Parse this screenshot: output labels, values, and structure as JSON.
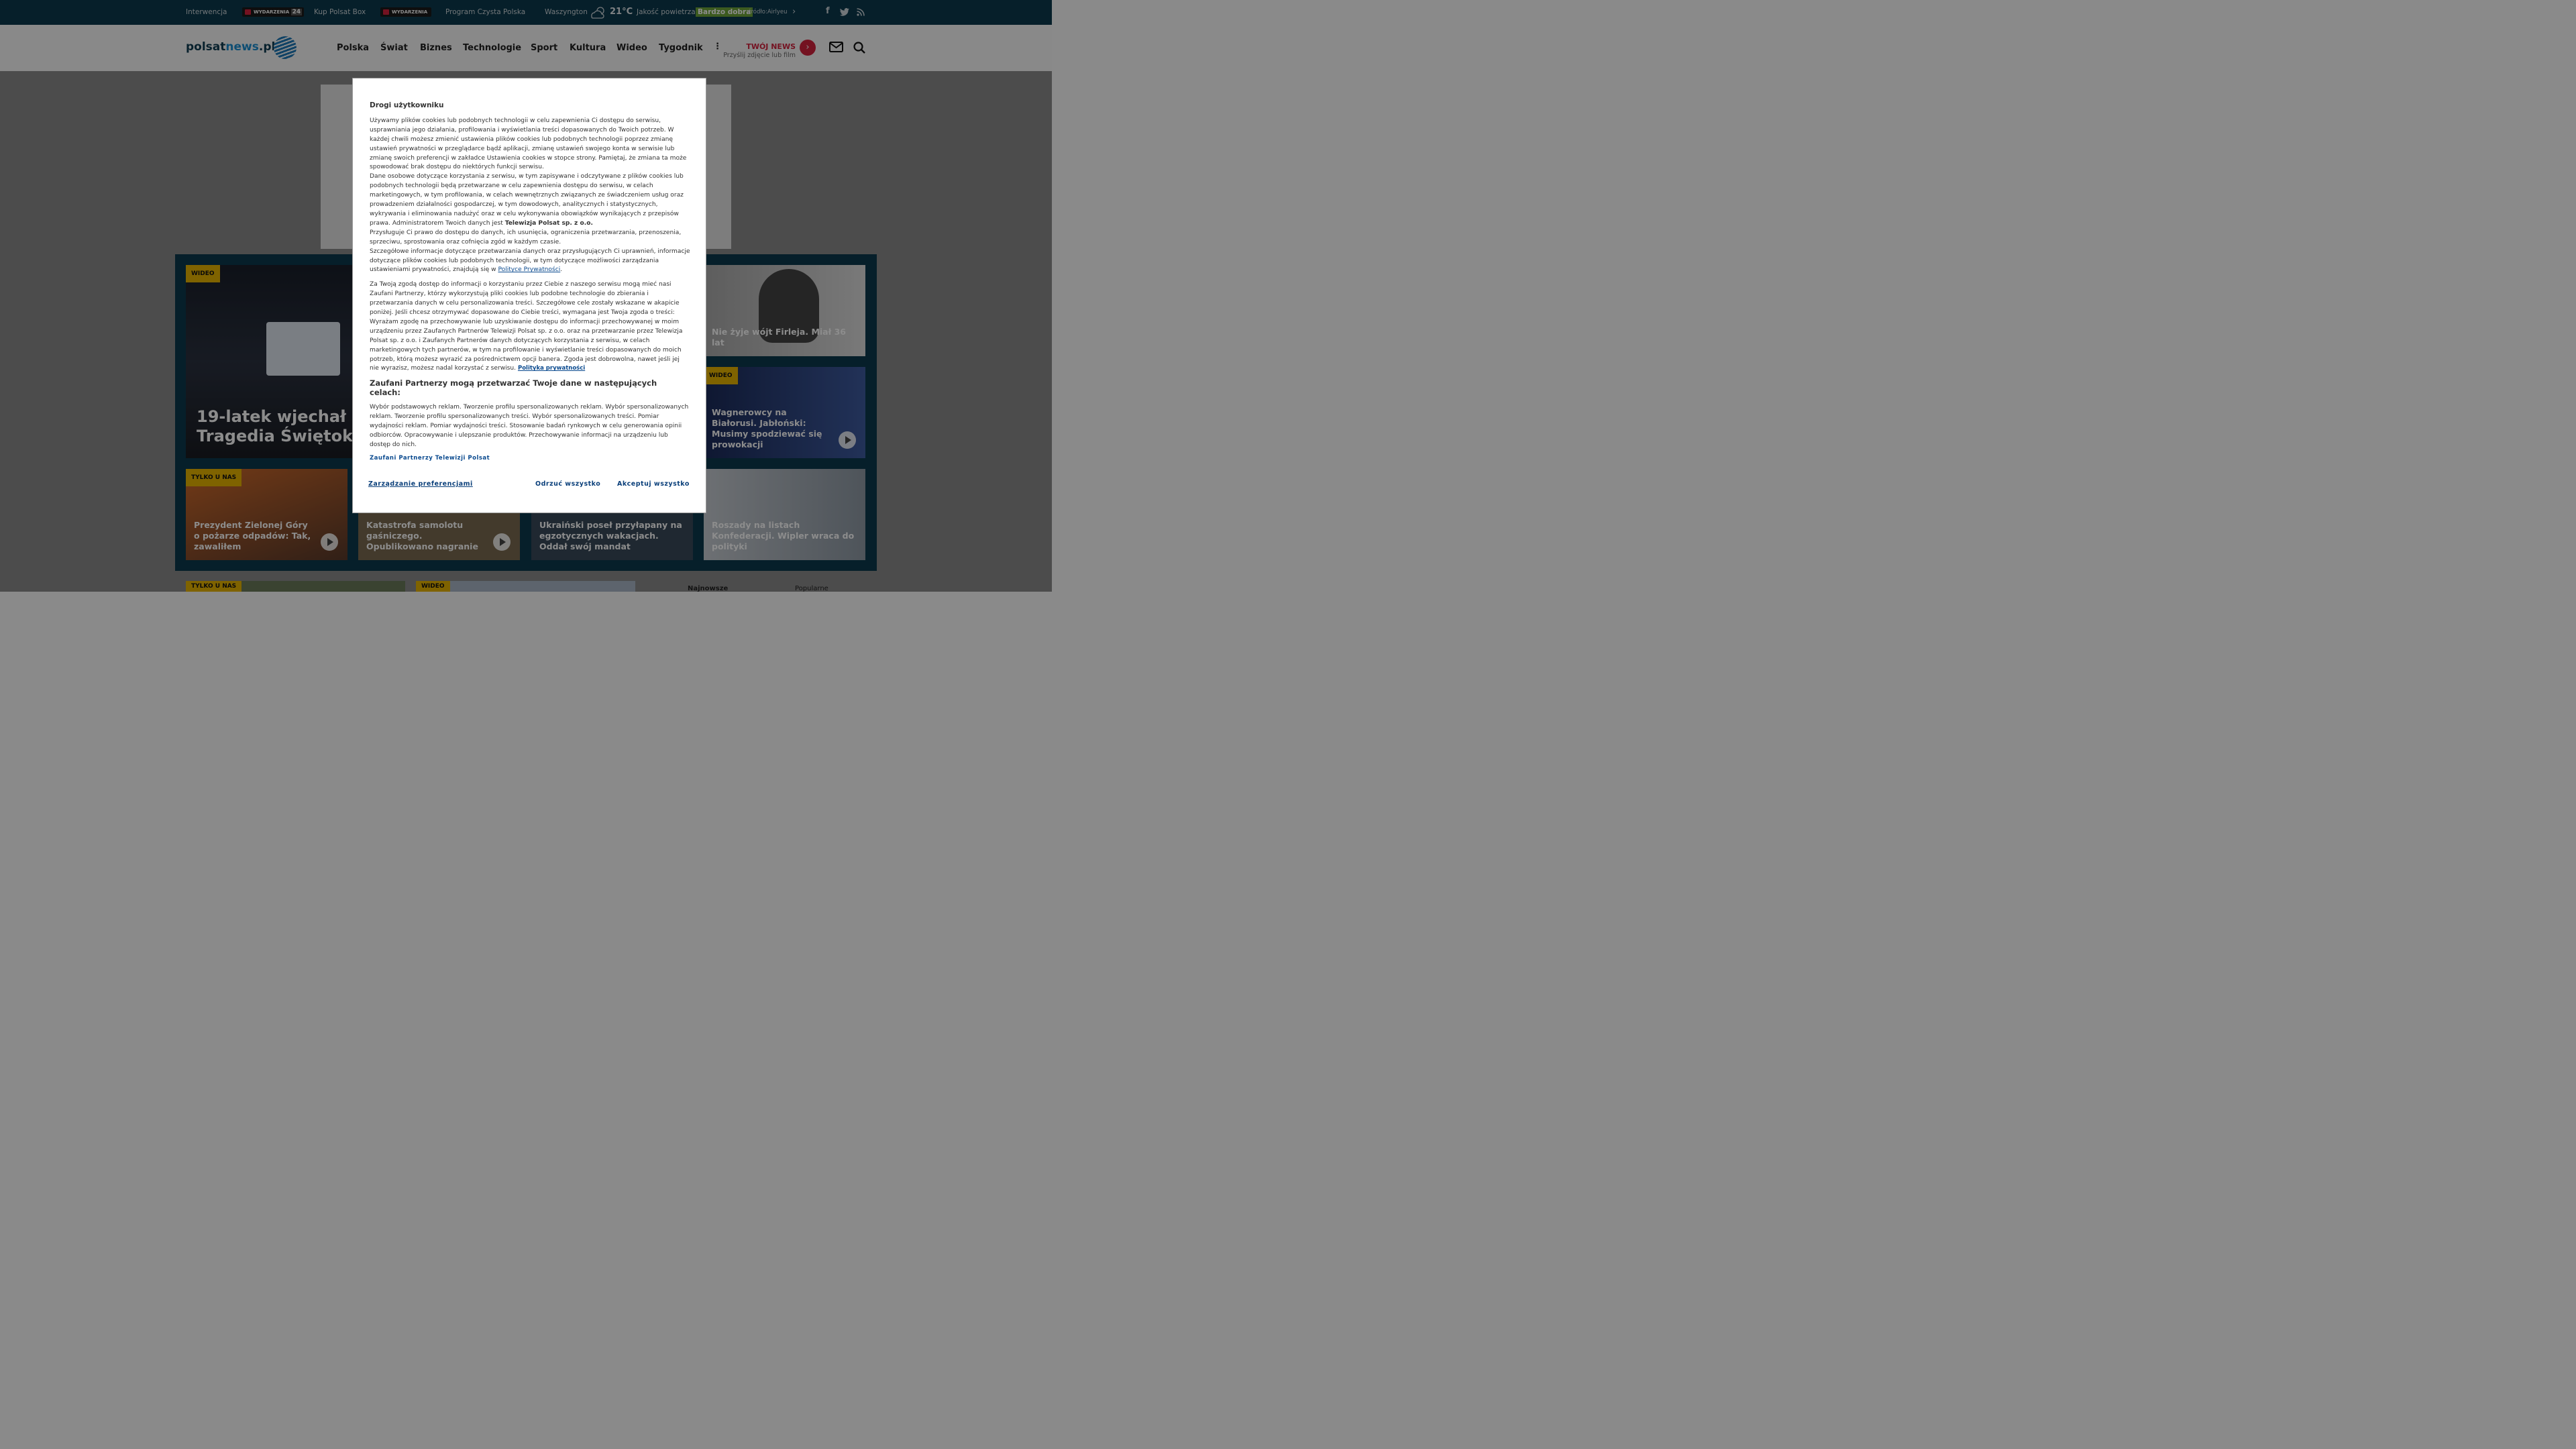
{
  "topbar": {
    "link1": "Interwencja",
    "tag1_label": "WYDARZENIA",
    "tag1_num": "24",
    "link2": "Kup Polsat Box",
    "tag2_label": "WYDARZENIA",
    "link3": "Program Czysta Polska",
    "city": "Waszyngton",
    "weather_icon": "cloud-rain-sun-icon",
    "temp": "21°C",
    "air_label": "Jakość powietrza",
    "air_value": "Bardzo dobra",
    "air_source": "źródło:Airlyeu",
    "social": [
      "facebook-icon",
      "twitter-icon",
      "rss-icon"
    ]
  },
  "header": {
    "logo_part1": "polsat",
    "logo_part2": "news",
    "logo_part3": ".pl",
    "nav": [
      "Polska",
      "Świat",
      "Biznes",
      "Technologie",
      "Sport",
      "Kultura",
      "Wideo",
      "Tygodnik"
    ],
    "twoj_title": "TWÓJ NEWS",
    "twoj_sub": "Przyślij zdjęcie lub film"
  },
  "cards": {
    "main_badge": "WIDEO",
    "main_title": "19-latek wjechał w p chodniku. Tragedia Świętokrzyskiem",
    "r1_title": "Nie żyje wójt Firleja. Miał 36 lat",
    "r2_badge": "WIDEO",
    "r2_title": "Wagnerowcy na Białorusi. Jabłoński: Musimy spodziewać się prowokacji",
    "b1_badge": "TYLKO U NAS",
    "b1_title": "Prezydent Zielonej Góry o pożarze odpadów: Tak, zawaliłem",
    "b2_title": "Katastrofa samolotu gaśniczego. Opublikowano nagranie",
    "b3_title": "Ukraiński poseł przyłapany na egzotycznych wakacjach. Oddał swój mandat",
    "b4_title": "Roszady na listach Konfederacji. Wipler wraca do polityki"
  },
  "bottom": {
    "badge1": "TYLKO U NAS",
    "badge2": "WIDEO",
    "tab1": "Najnowsze",
    "tab2": "Popularne"
  },
  "modal": {
    "title": "Drogi użytkowniku",
    "p1": "Używamy plików cookies lub podobnych technologii w celu zapewnienia Ci dostępu do serwisu, usprawniania jego działania, profilowania i wyświetlania treści dopasowanych do Twoich potrzeb. W każdej chwili możesz zmienić ustawienia plików cookies lub podobnych technologii poprzez zmianę ustawień prywatności w przeglądarce bądź aplikacji, zmianę ustawień swojego konta w serwisie lub zmianę swoich preferencji w zakładce Ustawienia cookies w stopce strony. Pamiętaj, że zmiana ta może spowodować brak dostępu do niektórych funkcji serwisu.",
    "p2": "Dane osobowe dotyczące korzystania z serwisu, w tym zapisywane i odczytywane z plików cookies lub podobnych technologii będą przetwarzane w celu zapewnienia dostępu do serwisu, w celach marketingowych, w tym profilowania, w celach wewnętrznych związanych ze świadczeniem usług oraz prowadzeniem działalności gospodarczej, w tym dowodowych, analitycznych i statystycznych, wykrywania i eliminowania nadużyć oraz w celu wykonywania obowiązków wynikających z przepisów prawa. Administratorem Twoich danych jest",
    "p2_bold": "Telewizja Polsat sp. z o.o.",
    "p3": "Przysługuje Ci prawo do dostępu do danych, ich usunięcia, ograniczenia przetwarzania, przenoszenia, sprzeciwu, sprostowania oraz cofnięcia zgód w każdym czasie.",
    "p4": "Szczegółowe informacje dotyczące przetwarzania danych oraz przysługujących Ci uprawnień, informacje dotyczące plików cookies lub podobnych technologii, w tym dotyczące możliwości zarządzania ustawieniami prywatności, znajdują się w",
    "p4_link": "Polityce Prywatności",
    "p5": "Za Twoją zgodą dostęp do informacji o korzystaniu przez Ciebie z naszego serwisu mogą mieć nasi Zaufani Partnerzy, którzy wykorzystują pliki cookies lub podobne technologie do zbierania i przetwarzania danych w celu personalizowania treści. Szczegółowe cele zostały wskazane w akapicie poniżej. Jeśli chcesz otrzymywać dopasowane do Ciebie treści, wymagana jest Twoja zgoda o treści: Wyrażam zgodę na przechowywanie lub uzyskiwanie dostępu do informacji przechowywanej w moim urządzeniu przez Zaufanych Partnerów Telewizji Polsat sp. z o.o. oraz na przetwarzanie przez Telewizja Polsat sp. z o.o. i Zaufanych Partnerów danych dotyczących korzystania z serwisu, w celach marketingowych tych partnerów, w tym na profilowanie i wyświetlanie treści dopasowanych do moich potrzeb, którą możesz wyrazić za pośrednictwem opcji banera. Zgoda jest dobrowolna, nawet jeśli jej nie wyrazisz, możesz nadal korzystać z serwisu.",
    "p5_link": "Polityka prywatności",
    "h2": "Zaufani Partnerzy mogą przetwarzać Twoje dane w następujących celach:",
    "p6": "Wybór podstawowych reklam. Tworzenie profilu spersonalizowanych reklam. Wybór spersonalizowanych reklam. Tworzenie profilu spersonalizowanych treści. Wybór spersonalizowanych treści. Pomiar wydajności reklam. Pomiar wydajności treści. Stosowanie badań rynkowych w celu generowania opinii odbiorców. Opracowywanie i ulepszanie produktów. Przechowywanie informacji na urządzeniu lub dostęp do nich.",
    "partners_link": "Zaufani Partnerzy Telewizji Polsat",
    "btn_manage": "Zarządzanie preferencjami",
    "btn_reject": "Odrzuć wszystko",
    "btn_accept": "Akceptuj wszystko"
  }
}
